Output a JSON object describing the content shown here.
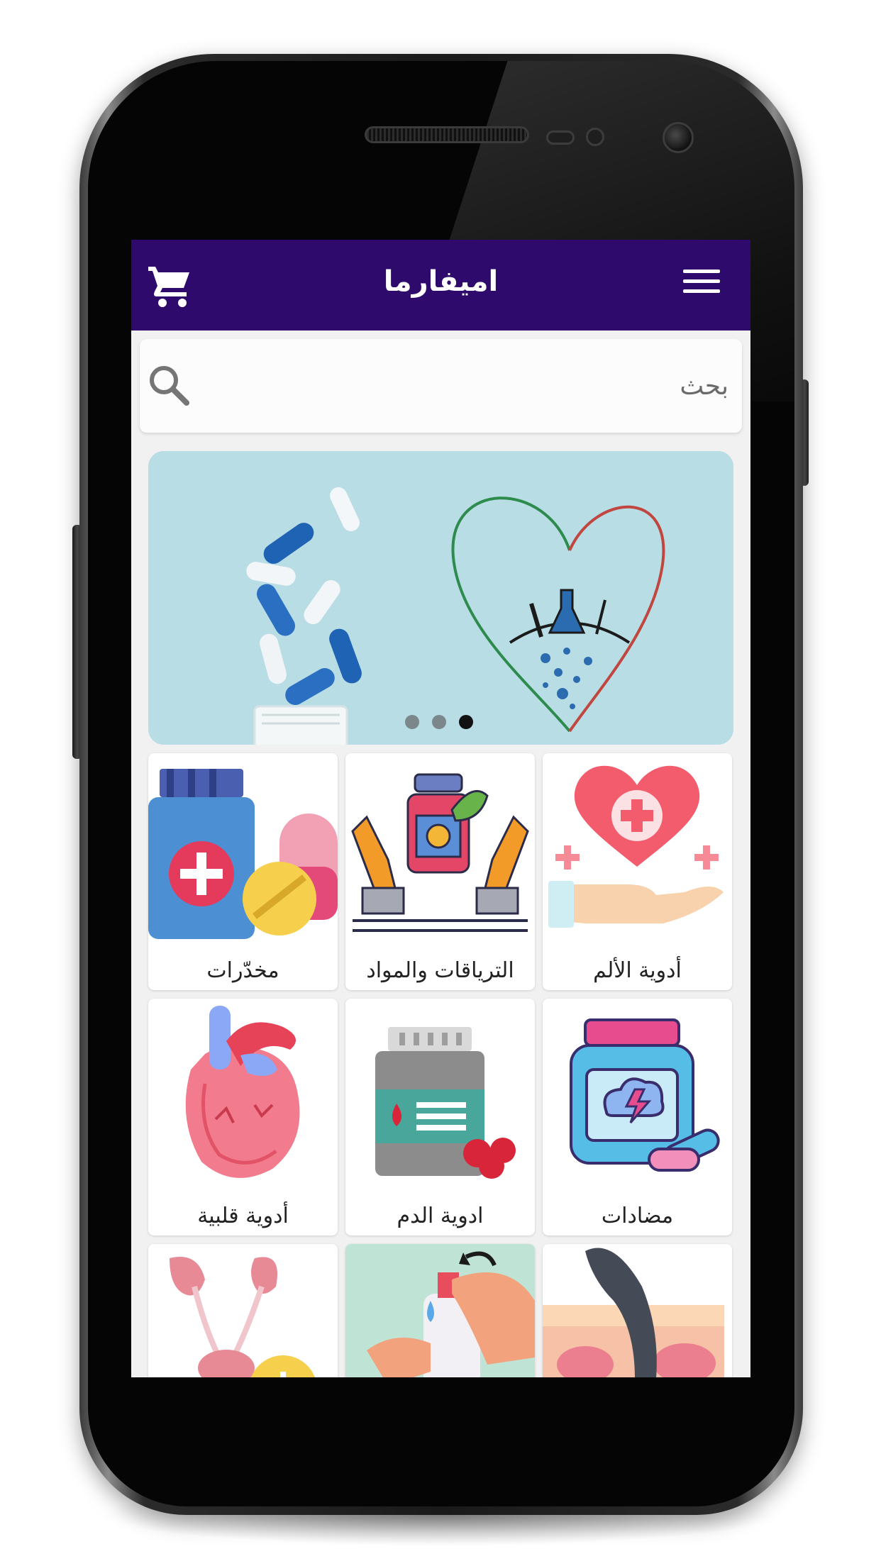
{
  "app": {
    "title": "اميفارما"
  },
  "appbar": {
    "background": "#2d0a6b",
    "cart_icon": "cart-icon",
    "menu_icon": "hamburger-menu-icon"
  },
  "search": {
    "placeholder": "بحث",
    "value": "",
    "icon": "search-icon"
  },
  "banner": {
    "slides_count": 3,
    "active_slide": 3
  },
  "categories": [
    {
      "label": "أدوية الألم",
      "icon": "heart-hand-icon"
    },
    {
      "label": "الترياقات والمواد",
      "icon": "hands-medicine-bottle-icon"
    },
    {
      "label": "مخدّرات",
      "icon": "pill-bottle-tablets-icon"
    },
    {
      "label": "مضادات",
      "icon": "pill-jar-icon"
    },
    {
      "label": "ادوية الدم",
      "icon": "blood-medicine-bottle-icon"
    },
    {
      "label": "أدوية قلبية",
      "icon": "human-heart-icon"
    },
    {
      "label": "",
      "icon": "skin-hair-icon"
    },
    {
      "label": "",
      "icon": "hand-wash-icon"
    },
    {
      "label": "",
      "icon": "kidneys-icon"
    }
  ]
}
